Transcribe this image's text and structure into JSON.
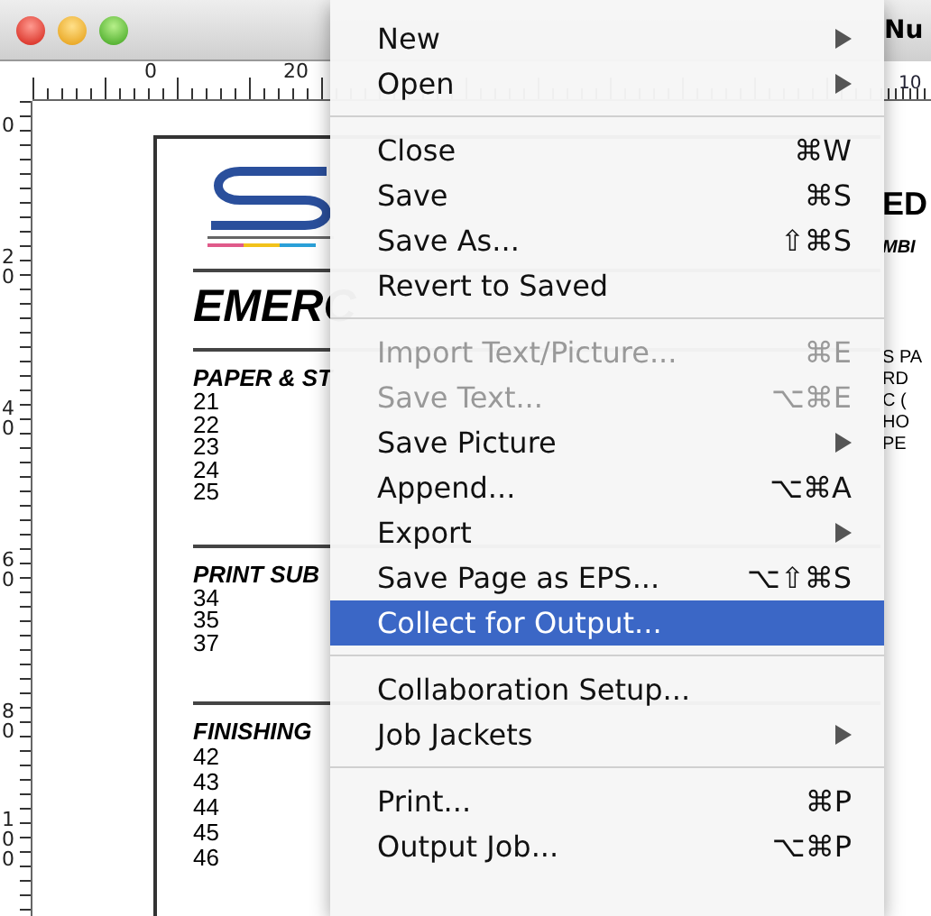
{
  "document_window": {
    "ruler_top_labels": [
      "0",
      "20"
    ],
    "ruler_left_labels": [
      "0",
      "20",
      "40",
      "60",
      "80",
      "100"
    ],
    "page": {
      "heading": "EMERC",
      "sections": [
        {
          "title": "PAPER & ST",
          "numbers": [
            "21",
            "22",
            "23",
            "24",
            "25"
          ]
        },
        {
          "title": "PRINT SUB",
          "numbers": [
            "34",
            "35",
            "37"
          ]
        },
        {
          "title": "FINISHING",
          "numbers": [
            "42",
            "43",
            "44",
            "45",
            "46"
          ]
        }
      ]
    }
  },
  "background_window": {
    "title": "Nu",
    "ruler_label": "10",
    "heading": "ED",
    "subheading": "MBI",
    "lines": [
      "S PA",
      "RD",
      "C (",
      "HO",
      "PE"
    ]
  },
  "file_menu": {
    "items": [
      {
        "kind": "item",
        "label": "New",
        "submenu": true,
        "disabled": false,
        "selected": false
      },
      {
        "kind": "item",
        "label": "Open",
        "submenu": true,
        "disabled": false,
        "selected": false
      },
      {
        "kind": "separator"
      },
      {
        "kind": "item",
        "label": "Close",
        "shortcut": "⌘W",
        "submenu": false,
        "disabled": false,
        "selected": false
      },
      {
        "kind": "item",
        "label": "Save",
        "shortcut": "⌘S",
        "submenu": false,
        "disabled": false,
        "selected": false
      },
      {
        "kind": "item",
        "label": "Save As...",
        "shortcut": "⇧⌘S",
        "submenu": false,
        "disabled": false,
        "selected": false
      },
      {
        "kind": "item",
        "label": "Revert to Saved",
        "submenu": false,
        "disabled": false,
        "selected": false
      },
      {
        "kind": "separator"
      },
      {
        "kind": "item",
        "label": "Import Text/Picture...",
        "shortcut": "⌘E",
        "submenu": false,
        "disabled": true,
        "selected": false
      },
      {
        "kind": "item",
        "label": "Save Text...",
        "shortcut": "⌥⌘E",
        "submenu": false,
        "disabled": true,
        "selected": false
      },
      {
        "kind": "item",
        "label": "Save Picture",
        "submenu": true,
        "disabled": false,
        "selected": false
      },
      {
        "kind": "item",
        "label": "Append...",
        "shortcut": "⌥⌘A",
        "submenu": false,
        "disabled": false,
        "selected": false
      },
      {
        "kind": "item",
        "label": "Export",
        "submenu": true,
        "disabled": false,
        "selected": false
      },
      {
        "kind": "item",
        "label": "Save Page as EPS...",
        "shortcut": "⌥⇧⌘S",
        "submenu": false,
        "disabled": false,
        "selected": false
      },
      {
        "kind": "item",
        "label": "Collect for Output...",
        "submenu": false,
        "disabled": false,
        "selected": true
      },
      {
        "kind": "separator"
      },
      {
        "kind": "item",
        "label": "Collaboration Setup...",
        "submenu": false,
        "disabled": false,
        "selected": false
      },
      {
        "kind": "item",
        "label": "Job Jackets",
        "submenu": true,
        "disabled": false,
        "selected": false
      },
      {
        "kind": "separator"
      },
      {
        "kind": "item",
        "label": "Print...",
        "shortcut": "⌘P",
        "submenu": false,
        "disabled": false,
        "selected": false
      },
      {
        "kind": "item",
        "label": "Output Job...",
        "shortcut": "⌥⌘P",
        "submenu": false,
        "disabled": false,
        "selected": false
      }
    ]
  }
}
